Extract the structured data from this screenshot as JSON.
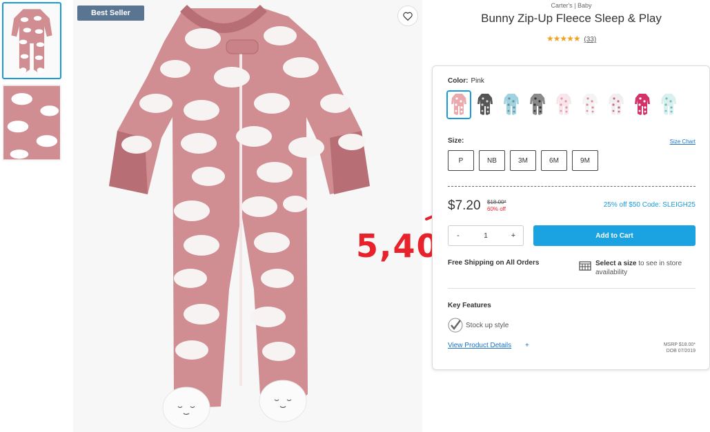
{
  "badge": "Best Seller",
  "product": {
    "brand": "Carter's | Baby",
    "title": "Bunny Zip-Up Fleece Sleep & Play",
    "stars": "★★★★★",
    "review_count": "(33)",
    "rating": 5
  },
  "color": {
    "label": "Color:",
    "value": "Pink",
    "swatches": [
      {
        "name": "pink-bunny",
        "body": "#e9a9ad",
        "pattern": "#ffffff"
      },
      {
        "name": "charcoal",
        "body": "#555555",
        "pattern": "#d8d8d8"
      },
      {
        "name": "light-blue",
        "body": "#9fd3de",
        "pattern": "#6e8fa0"
      },
      {
        "name": "grey",
        "body": "#8a8a8a",
        "pattern": "#333333"
      },
      {
        "name": "white-pink",
        "body": "#f7e6ea",
        "pattern": "#e597ab"
      },
      {
        "name": "white-heart",
        "body": "#f4f4f4",
        "pattern": "#e08aa0"
      },
      {
        "name": "white-floral",
        "body": "#f1eef0",
        "pattern": "#c86a8a"
      },
      {
        "name": "magenta",
        "body": "#d4336a",
        "pattern": "#ffffff"
      },
      {
        "name": "mint",
        "body": "#d9f0ef",
        "pattern": "#6fbfbf"
      }
    ]
  },
  "size": {
    "label": "Size:",
    "chart_link": "Size Chart",
    "options": [
      "P",
      "NB",
      "3M",
      "6M",
      "9M"
    ]
  },
  "price": {
    "current": "$7.20",
    "original": "$18.00*",
    "discount": "60% off",
    "promo": "25% off $50 Code: SLEIGH25"
  },
  "cart": {
    "minus": "-",
    "quantity": "1",
    "plus": "+",
    "add_label": "Add to Cart"
  },
  "shipping": {
    "free": "Free Shipping on All Orders",
    "store_bold": "Select a size",
    "store_rest": " to see in store availability"
  },
  "features": {
    "heading": "Key Features",
    "items": [
      "Stock up style"
    ],
    "details_link": "View Product Details",
    "details_plus": "+",
    "msrp": "MSRP $18.00*",
    "dob": "DOB 07/2019"
  },
  "annotation": "5,40",
  "colors": {
    "accent": "#1aa3e0",
    "badge": "#5a7592",
    "star": "#f1a11f",
    "annotation": "#e8222a",
    "product_pink": "#d08d92"
  }
}
